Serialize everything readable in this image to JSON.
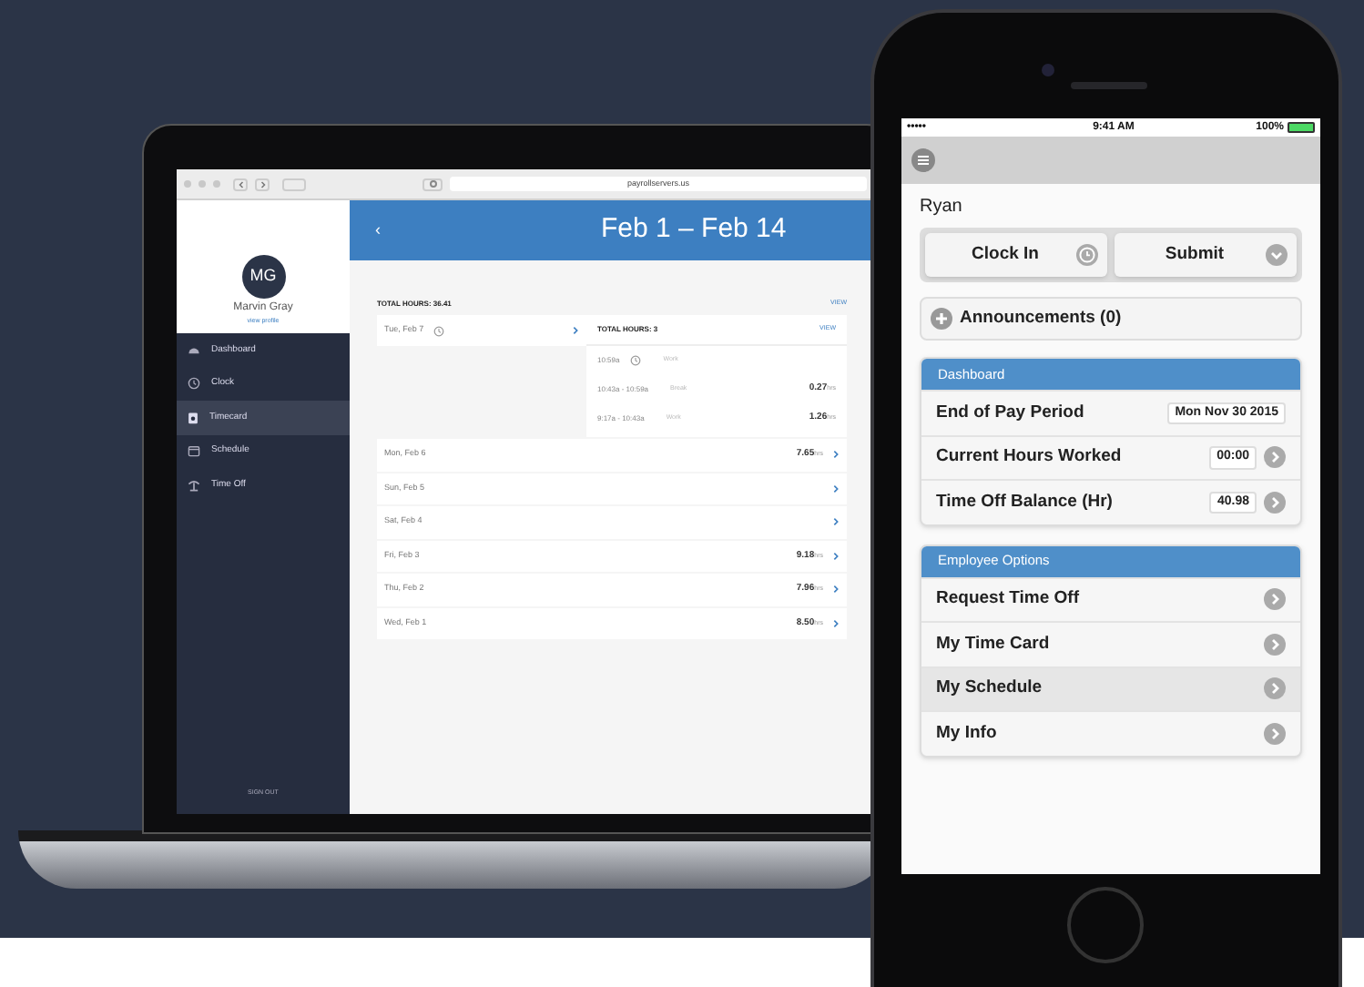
{
  "laptop": {
    "browser": {
      "url": "payrollservers.us"
    },
    "sidebar": {
      "initials": "MG",
      "name": "Marvin Gray",
      "profile_link": "view profile",
      "sign_out": "SIGN OUT",
      "items": [
        {
          "label": "Dashboard",
          "selected": false
        },
        {
          "label": "Clock",
          "selected": false
        },
        {
          "label": "Timecard",
          "selected": true
        },
        {
          "label": "Schedule",
          "selected": false
        },
        {
          "label": "Time Off",
          "selected": false
        }
      ]
    },
    "header": {
      "back": "‹",
      "title": "Feb 1 – Feb 14"
    },
    "total_hours": "TOTAL HOURS: 36.41",
    "view_link": "VIEW",
    "rows": [
      {
        "date": "Tue, Feb 7",
        "expanded": true,
        "clocked_in": true,
        "detail": {
          "total": "TOTAL HOURS: 3",
          "view_link": "VIEW",
          "entries": [
            {
              "time": "10:59a",
              "clocked_in": true,
              "type": "Work"
            },
            {
              "time": "10:43a - 10:59a",
              "clocked_in": false,
              "type": "Break",
              "hours": "0.27",
              "unit": "hrs"
            },
            {
              "time": "9:17a - 10:43a",
              "clocked_in": false,
              "type": "Work",
              "hours": "1.26",
              "unit": "hrs"
            }
          ]
        }
      },
      {
        "date": "Mon, Feb 6",
        "expanded": false,
        "clocked_in": false,
        "hours": "7.65",
        "unit": "hrs"
      },
      {
        "date": "Sun, Feb 5",
        "expanded": false,
        "clocked_in": false
      },
      {
        "date": "Sat, Feb 4",
        "expanded": false,
        "clocked_in": false
      },
      {
        "date": "Fri, Feb 3",
        "expanded": false,
        "clocked_in": false,
        "hours": "9.18",
        "unit": "hrs"
      },
      {
        "date": "Thu, Feb 2",
        "expanded": false,
        "clocked_in": false,
        "hours": "7.96",
        "unit": "hrs"
      },
      {
        "date": "Wed, Feb 1",
        "expanded": false,
        "clocked_in": false,
        "hours": "8.50",
        "unit": "hrs"
      }
    ]
  },
  "phone": {
    "status_bar": {
      "signal": "•••••",
      "time": "9:41 AM",
      "battery": "100%"
    },
    "user": "Ryan",
    "buttons": [
      {
        "label": "Clock In",
        "kind": "clock"
      },
      {
        "label": "Submit",
        "kind": "dropdown"
      }
    ],
    "announcements": "Announcements (0)",
    "dashboard": {
      "title": "Dashboard",
      "rows": [
        {
          "label": "End of Pay Period",
          "value": "Mon Nov 30 2015",
          "has_arrow": false
        },
        {
          "label": "Current Hours Worked",
          "value": "00:00",
          "has_arrow": true
        },
        {
          "label": "Time Off Balance (Hr)",
          "value": "40.98",
          "has_arrow": true
        }
      ]
    },
    "employee_options": {
      "title": "Employee Options",
      "items": [
        {
          "label": "Request Time Off",
          "selected": false
        },
        {
          "label": "My Time Card",
          "selected": false
        },
        {
          "label": "My Schedule",
          "selected": true
        },
        {
          "label": "My Info",
          "selected": false
        }
      ]
    }
  }
}
